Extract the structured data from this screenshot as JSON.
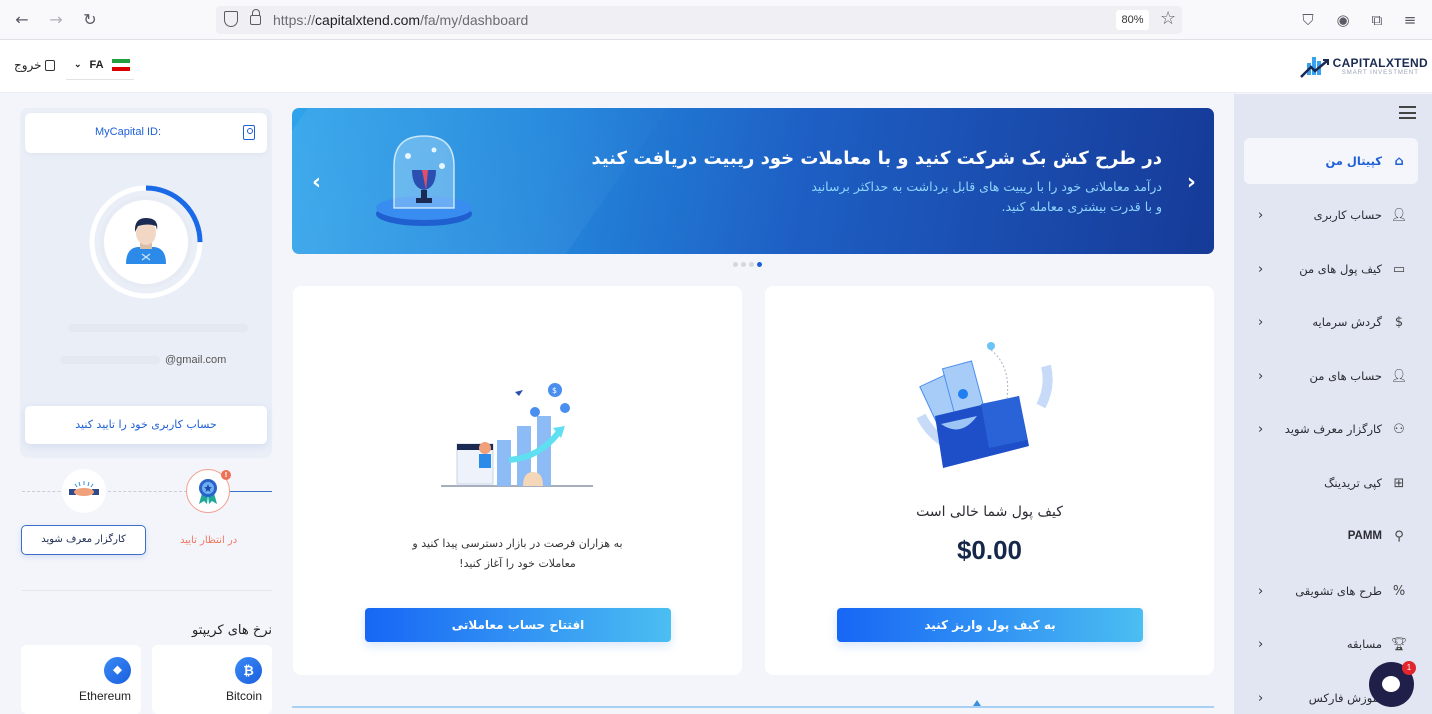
{
  "browser": {
    "url_prefix": "https://",
    "url_domain": "capitalxtend.com",
    "url_path": "/fa/my/dashboard",
    "zoom": "80%",
    "icons": [
      "back-icon",
      "forward-icon",
      "reload-icon",
      "shield-icon",
      "lock-icon",
      "star-icon",
      "pocket-icon",
      "account-icon",
      "extensions-icon",
      "menu-icon"
    ]
  },
  "header": {
    "logout_label": "خروج",
    "language": "FA",
    "logo_title": "CAPITALXTEND",
    "logo_subtitle": "SMART INVESTMENT"
  },
  "sidebar": {
    "items": [
      {
        "label": "کپیتال من",
        "icon": "home-chart-icon",
        "active": true,
        "has_chevron": false
      },
      {
        "label": "حساب کاربری",
        "icon": "user-icon",
        "active": false,
        "has_chevron": true
      },
      {
        "label": "کیف پول های من",
        "icon": "wallet-icon",
        "active": false,
        "has_chevron": true
      },
      {
        "label": "گردش سرمایه",
        "icon": "money-hand-icon",
        "active": false,
        "has_chevron": true
      },
      {
        "label": "حساب های من",
        "icon": "user-chart-icon",
        "active": false,
        "has_chevron": true
      },
      {
        "label": "کارگزار معرف شوید",
        "icon": "group-icon",
        "active": false,
        "has_chevron": true
      },
      {
        "label": "کپی تریدینگ",
        "icon": "copy-network-icon",
        "active": false,
        "has_chevron": false
      },
      {
        "label": "PAMM",
        "icon": "pamm-users-icon",
        "active": false,
        "has_chevron": false
      },
      {
        "label": "طرح های تشویقی",
        "icon": "percent-badge-icon",
        "active": false,
        "has_chevron": true
      },
      {
        "label": "مسابقه",
        "icon": "trophy-icon",
        "active": false,
        "has_chevron": true
      },
      {
        "label": "آموزش فارکس",
        "icon": "education-icon",
        "active": false,
        "has_chevron": true
      }
    ]
  },
  "profile": {
    "id_label": "MyCapital ID:",
    "email": "@gmail.com",
    "profile_progress": 0.25,
    "verify_button": "حساب کاربری خود را تایید کنید",
    "steps": {
      "pending_label": "در انتظار تایید",
      "pending_badge": "!",
      "referral_button": "کارگزار معرف شوید"
    }
  },
  "crypto": {
    "title": "نرخ های کریپتو",
    "coins": [
      {
        "name": "Bitcoin",
        "symbol": "₿"
      },
      {
        "name": "Ethereum",
        "symbol": "◆"
      }
    ]
  },
  "banner": {
    "title": "در طرح کش بک شرکت کنید و با معاملات خود ریبیت دریافت کنید",
    "subtitle": "درآمد معاملاتی خود را با ریبیت های قابل برداشت به حداکثر برسانید و با قدرت بیشتری معامله کنید.",
    "prev": "‹",
    "next": "›",
    "slide_count": 4,
    "active_slide": 4
  },
  "wallet_card": {
    "title": "کیف پول شما خالی است",
    "balance": "$0.00",
    "button": "به کیف پول واریز کنید"
  },
  "trading_card": {
    "text": "به هزاران فرصت در بازار دسترسی پیدا کنید و معاملات خود را آغاز کنید!",
    "button": "افتتاح حساب معاملاتی"
  },
  "chat": {
    "badge": "1"
  }
}
